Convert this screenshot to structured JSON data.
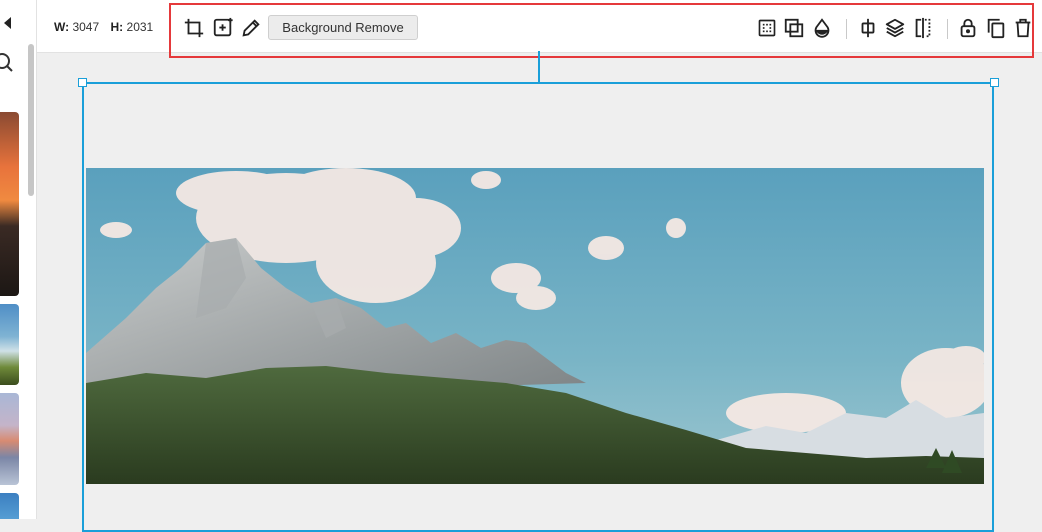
{
  "sidebar": {
    "collapse_icon": "caret-left-icon",
    "search_icon": "search-icon",
    "thumbnails": [
      "sunset-photo",
      "landscape-photo",
      "mountain-lake-photo",
      "sky-photo"
    ]
  },
  "dimensions": {
    "w_label": "W:",
    "w_value": "3047",
    "h_label": "H:",
    "h_value": "2031"
  },
  "toolbar": {
    "left_tools": [
      "crop-icon",
      "add-image-icon",
      "pencil-icon"
    ],
    "background_remove_label": "Background Remove",
    "right_tools": [
      "transparency-grid-icon",
      "overlap-icon",
      "drop-icon",
      "align-center-icon",
      "layers-icon",
      "flip-icon",
      "lock-icon",
      "duplicate-icon",
      "delete-icon"
    ],
    "highlight_color": "#e5393b"
  },
  "canvas": {
    "selection_color": "#1a9fd9",
    "image": "mountain-landscape-photo"
  }
}
